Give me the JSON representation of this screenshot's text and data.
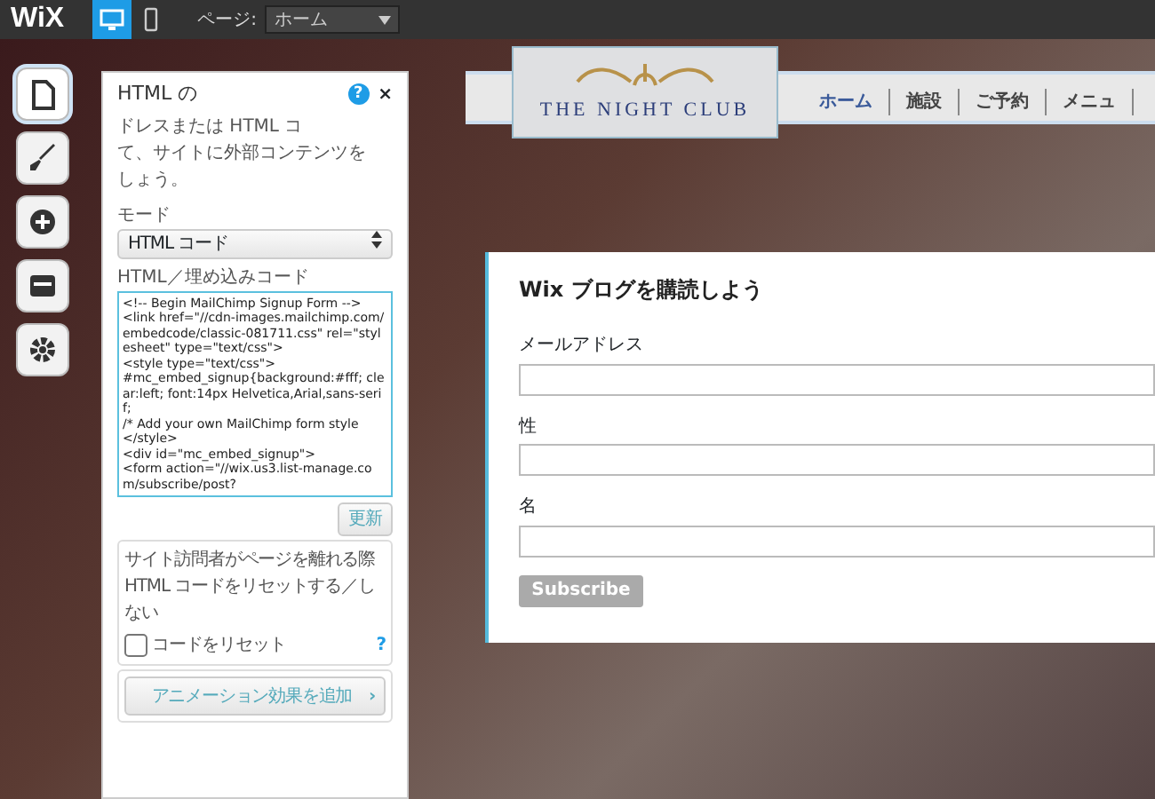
{
  "top_bar": {
    "logo": "WiX",
    "views": [
      {
        "kind": "desktop",
        "selected": true
      },
      {
        "kind": "mobile",
        "selected": false
      }
    ],
    "page_label": "ページ:",
    "page_value": "ホーム"
  },
  "tools": [
    {
      "kind": "page",
      "selected": true
    },
    {
      "kind": "brush",
      "selected": false
    },
    {
      "kind": "add",
      "selected": false
    },
    {
      "kind": "store",
      "selected": false
    },
    {
      "kind": "settings",
      "selected": false
    }
  ],
  "panel": {
    "title": "HTML の",
    "help": "?",
    "close": "×",
    "description": [
      "ドレスまたは HTML コ",
      "て、サイトに外部コンテンツを",
      "しょう。"
    ],
    "mode_label": "モード",
    "mode_value": "HTML コード",
    "code_label": "HTML／埋め込みコード",
    "code_lines": [
      "<!-- Begin MailChimp Signup Form -->",
      "<link href=\"//cdn-images.mailchimp.com/embedcode/classic-081711.css\" rel=\"stylesheet\" type=\"text/css\">",
      "<style type=\"text/css\">",
      "#mc_embed_signup{background:#fff; clear:left; font:14px Helvetica,Arial,sans-serif;",
      "/* Add your own MailChimp form style",
      "</style>",
      "<div id=\"mc_embed_signup\">",
      "<form action=\"//wix.us3.list-manage.com/subscribe/post?"
    ],
    "update_button": "更新",
    "reset_text": [
      "サイト訪問者がページを離れる際",
      "HTML コードをリセットする／しない"
    ],
    "reset_checkbox": {
      "label": "コードをリセット",
      "checked": false
    },
    "reset_help": "?",
    "animation_button": "アニメーション効果を追加",
    "animation_arrow": "›"
  },
  "site": {
    "logo_text": "THE NIGHT CLUB",
    "nav": [
      {
        "label": "ホーム",
        "selected": true
      },
      {
        "label": "施設",
        "selected": false
      },
      {
        "label": "ご予約",
        "selected": false
      },
      {
        "label": "メニュ",
        "selected": false
      }
    ],
    "form": {
      "title": "Wix ブログを購読しよう",
      "fields": [
        {
          "label": "メールアドレス"
        },
        {
          "label": "性"
        },
        {
          "label": "名"
        }
      ],
      "button": "Subscribe"
    }
  }
}
